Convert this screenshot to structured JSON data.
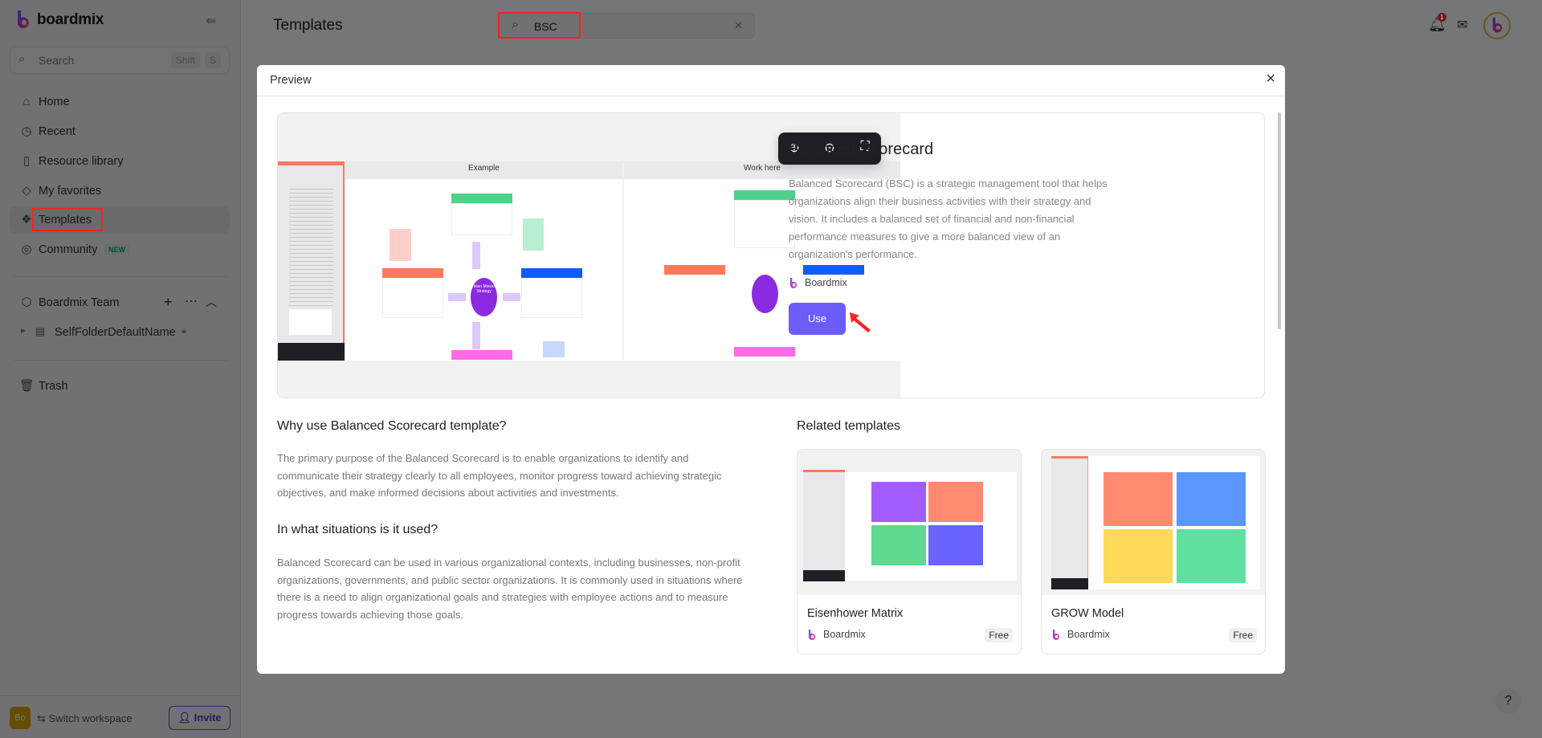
{
  "app": {
    "name": "boardmix"
  },
  "sidebar": {
    "search_placeholder": "Search",
    "shortcut_keys": [
      "Shift",
      "S"
    ],
    "items": [
      {
        "label": "Home",
        "icon": "home-icon"
      },
      {
        "label": "Recent",
        "icon": "clock-icon"
      },
      {
        "label": "Resource library",
        "icon": "library-icon"
      },
      {
        "label": "My favorites",
        "icon": "tag-icon"
      },
      {
        "label": "Templates",
        "icon": "templates-icon",
        "active": true
      },
      {
        "label": "Community",
        "icon": "planet-icon",
        "badge": "NEW"
      }
    ],
    "team": {
      "label": "Boardmix Team"
    },
    "folder": {
      "label": "SelfFolderDefaultName"
    },
    "trash": "Trash",
    "workspace_avatar": "Bo",
    "switch_workspace": "⇆ Switch workspace",
    "invite": "Invite"
  },
  "header": {
    "title": "Templates",
    "search_value": "BSC",
    "notification_count": "1"
  },
  "modal": {
    "title": "Preview",
    "preview": {
      "example_label": "Example",
      "work_label": "Work here",
      "center_label": "Vision Mission Strategy"
    },
    "template": {
      "title": "Balanced Scorecard",
      "description": "Balanced Scorecard (BSC) is a strategic management tool that helps organizations align their business activities with their strategy and vision. It includes a balanced set of financial and non-financial performance measures to give a more balanced view of an organization's performance.",
      "author": "Boardmix",
      "use_label": "Use"
    },
    "why": {
      "heading": "Why use Balanced Scorecard template?",
      "text": "The primary purpose of the Balanced Scorecard is to enable organizations to identify and communicate their strategy clearly to all employees, monitor progress toward achieving strategic objectives, and make informed decisions about activities and investments."
    },
    "situations": {
      "heading": "In what situations is it used?",
      "text": "Balanced Scorecard can be used in various organizational contexts, including businesses, non-profit organizations, governments, and public sector organizations. It is commonly used in situations where there is a need to align organizational goals and strategies with employee actions and to measure progress towards achieving those goals."
    },
    "related": {
      "heading": "Related templates",
      "items": [
        {
          "name": "Eisenhower Matrix",
          "author": "Boardmix",
          "price": "Free"
        },
        {
          "name": "GROW Model",
          "author": "Boardmix",
          "price": "Free"
        }
      ]
    }
  },
  "help": "?",
  "colors": {
    "accent": "#6c5cfa",
    "annotation": "#ff2020",
    "finance": "#4fd18b",
    "customer": "#ff7a5c",
    "internal": "#0d5cff",
    "learning": "#ff6be6",
    "center": "#8a2be2"
  }
}
